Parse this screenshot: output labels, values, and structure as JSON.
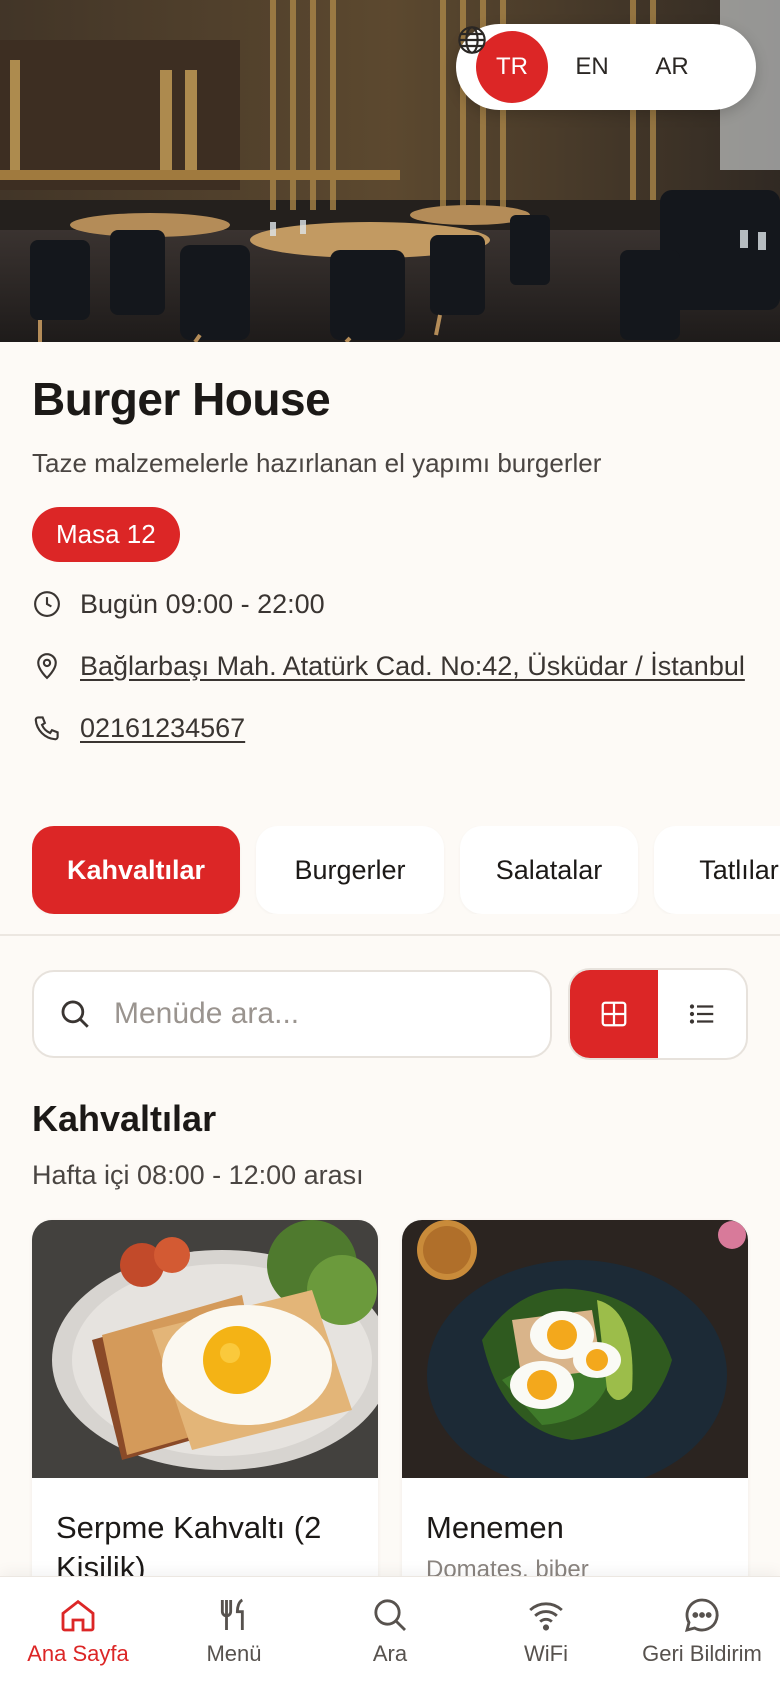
{
  "hero": {
    "image": "restaurant-interior-photo"
  },
  "languages": {
    "items": [
      "TR",
      "EN",
      "AR"
    ],
    "active": "TR"
  },
  "restaurant": {
    "name": "Burger House",
    "tagline": "Taze malzemelerle hazırlanan el yapımı burgerler",
    "table": "Masa 12",
    "hours": "Bugün 09:00 - 22:00",
    "address": "Bağlarbaşı Mah. Atatürk Cad. No:42, Üsküdar / İstanbul",
    "phone": "02161234567"
  },
  "categories": [
    {
      "label": "Kahvaltılar",
      "active": true
    },
    {
      "label": "Burgerler",
      "active": false
    },
    {
      "label": "Salatalar",
      "active": false
    },
    {
      "label": "Tatlılar",
      "active": false
    }
  ],
  "search": {
    "placeholder": "Menüde ara..."
  },
  "view_mode": "grid",
  "section": {
    "title": "Kahvaltılar",
    "subtitle": "Hafta içi 08:00 - 12:00 arası"
  },
  "items": [
    {
      "name": "Serpme Kahvaltı (2 Kişilik)",
      "description": "",
      "image": "toast-egg-photo"
    },
    {
      "name": "Menemen",
      "description": "Domates, biber",
      "image": "egg-avocado-photo"
    }
  ],
  "nav": [
    {
      "label": "Ana Sayfa",
      "icon": "home-icon",
      "active": true
    },
    {
      "label": "Menü",
      "icon": "fork-knife-icon",
      "active": false
    },
    {
      "label": "Ara",
      "icon": "search-icon",
      "active": false
    },
    {
      "label": "WiFi",
      "icon": "wifi-icon",
      "active": false
    },
    {
      "label": "Geri Bildirim",
      "icon": "chat-icon",
      "active": false
    }
  ],
  "colors": {
    "accent": "#dc2626",
    "background": "#fdfaf6"
  }
}
